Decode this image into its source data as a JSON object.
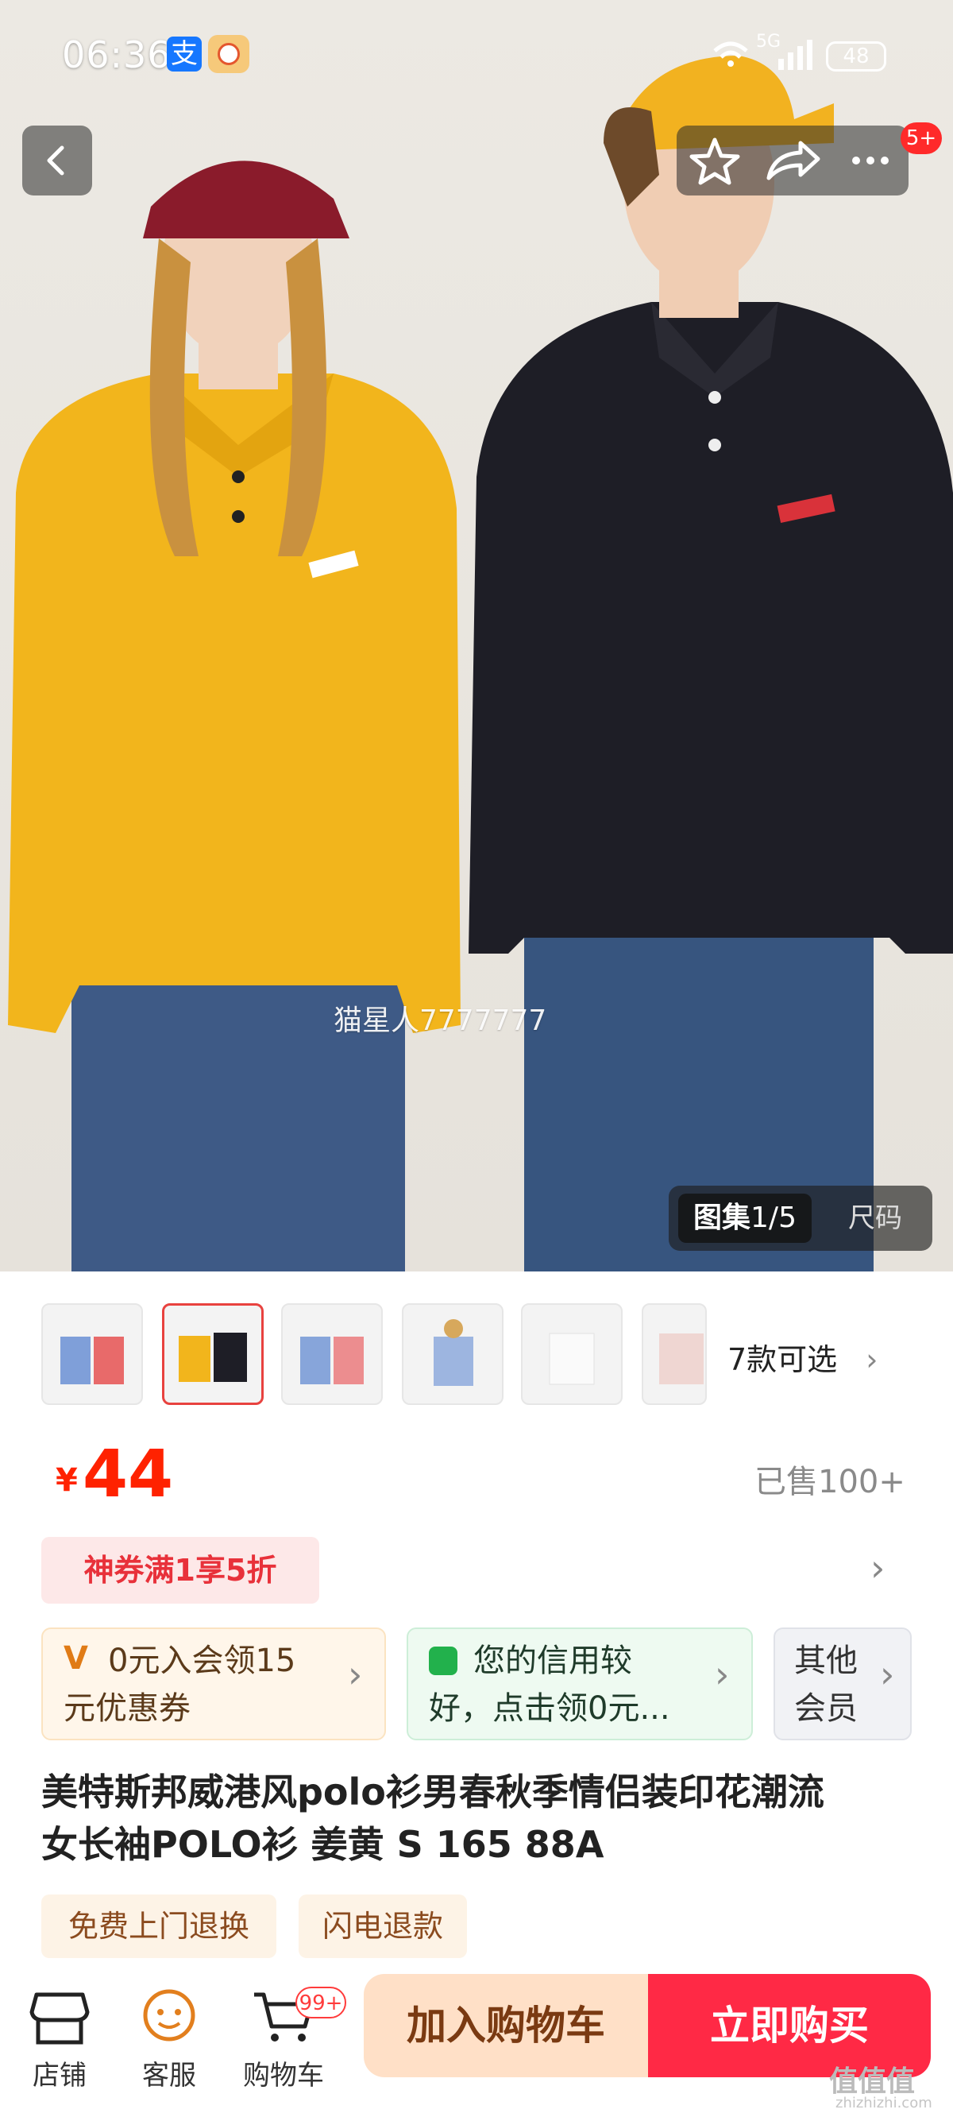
{
  "status_bar": {
    "time": "06:36",
    "pay_icon_text": "支",
    "network": "5G",
    "battery": "48"
  },
  "hero": {
    "watermark": "猫星人7777777",
    "gallery_label": "图集",
    "gallery_index": "1/5",
    "size_label": "尺码",
    "notification_badge": "5+"
  },
  "variants": {
    "label": "7款可选",
    "count_shown": 6,
    "selected_index": 1
  },
  "price": {
    "symbol": "¥",
    "amount": "44",
    "sold": "已售100+"
  },
  "coupon": {
    "label": "神券满1享5折"
  },
  "benefits": [
    {
      "text_line1": "0元入会领15",
      "text_line2": "元优惠券"
    },
    {
      "text_line1": "您的信用较",
      "text_line2": "好，点击领0元..."
    },
    {
      "text_line1": "其他",
      "text_line2": "会员"
    }
  ],
  "product": {
    "title_line1": "美特斯邦威港风polo衫男春秋季情侣装印花潮流",
    "title_line2": "女长袖POLO衫 姜黄 S 165 88A"
  },
  "services": [
    "免费上门退换",
    "闪电退款"
  ],
  "bottom_nav": {
    "shop": "店铺",
    "service": "客服",
    "cart": "购物车",
    "cart_badge": "99+",
    "add_to_cart": "加入购物车",
    "buy_now": "立即购买"
  },
  "site_watermark": {
    "main": "值值值",
    "sub": "zhizhizhi.com"
  },
  "colors": {
    "accent": "#ff2200",
    "buy": "#ff2945",
    "cart_btn": "#ffe0c7",
    "yellow_shirt": "#f2b51c",
    "black_shirt": "#1e1e26"
  }
}
